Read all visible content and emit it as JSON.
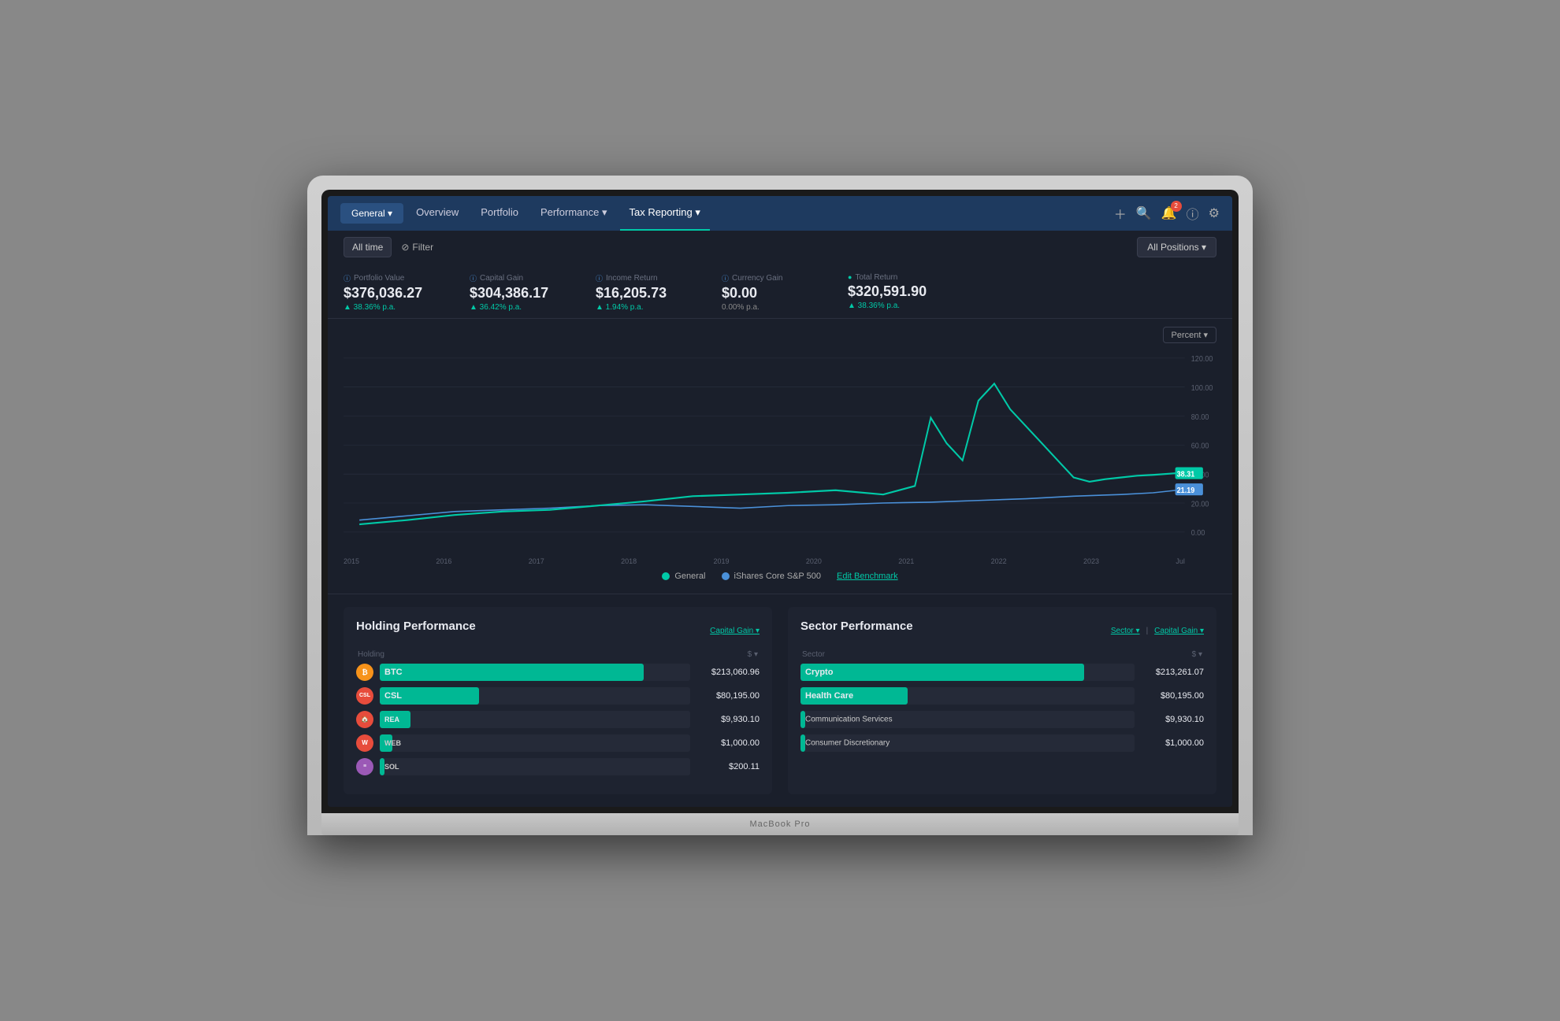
{
  "nav": {
    "general_label": "General ▾",
    "overview_label": "Overview",
    "portfolio_label": "Portfolio",
    "performance_label": "Performance ▾",
    "tax_reporting_label": "Tax Reporting ▾",
    "notification_count": "2"
  },
  "toolbar": {
    "time_filter": "All time",
    "filter_label": "Filter",
    "positions_label": "All Positions ▾"
  },
  "metrics": {
    "portfolio_value_label": "Portfolio Value",
    "portfolio_value": "$376,036.27",
    "portfolio_change": "▲ 38.36% p.a.",
    "capital_gain_label": "Capital Gain",
    "capital_gain": "$304,386.17",
    "capital_gain_change": "▲ 36.42% p.a.",
    "income_return_label": "Income Return",
    "income_return": "$16,205.73",
    "income_return_change": "▲ 1.94% p.a.",
    "currency_gain_label": "Currency Gain",
    "currency_gain": "$0.00",
    "currency_gain_change": "0.00% p.a.",
    "total_return_label": "Total Return",
    "total_return": "$320,591.90",
    "total_return_change": "▲ 38.36% p.a."
  },
  "chart": {
    "type_label": "Percent ▾",
    "y_labels": [
      "120.00",
      "100.00",
      "80.00",
      "60.00",
      "40.00",
      "20.00",
      "0.00"
    ],
    "x_labels": [
      "2015",
      "2016",
      "2017",
      "2018",
      "2019",
      "2020",
      "2021",
      "2022",
      "2023",
      "Jul"
    ],
    "general_tag": "38.31",
    "benchmark_tag": "21.19",
    "legend_general": "General",
    "legend_benchmark": "iShares Core S&P 500",
    "edit_benchmark": "Edit Benchmark"
  },
  "holding_performance": {
    "title": "Holding Performance",
    "col_holding": "Holding",
    "col_value": "$ ▾",
    "sort_label": "Capital Gain ▾",
    "rows": [
      {
        "ticker": "BTC",
        "color": "#f7931a",
        "bg": "#f7931a",
        "bar_pct": 85,
        "bar_color": "#00b894",
        "value": "$213,060.96"
      },
      {
        "ticker": "CSL",
        "color": "#e74c3c",
        "bg": "#e74c3c",
        "bar_pct": 32,
        "bar_color": "#00b894",
        "value": "$80,195.00"
      },
      {
        "ticker": "REA",
        "color": "#e74c3c",
        "bg": "#e74c3c",
        "bar_pct": 10,
        "bar_color": "#00b894",
        "value": "$9,930.10"
      },
      {
        "ticker": "WEB",
        "color": "#e74c3c",
        "bg": "#e74c3c",
        "bar_pct": 4,
        "bar_color": "#00b894",
        "value": "$1,000.00"
      },
      {
        "ticker": "SOL",
        "color": "#9b59b6",
        "bg": "#9b59b6",
        "bar_pct": 1,
        "bar_color": "#00b894",
        "value": "$200.11"
      }
    ]
  },
  "sector_performance": {
    "title": "Sector Performance",
    "col_sector": "Sector",
    "col_value": "$ ▾",
    "sort_sector": "Sector ▾",
    "sort_capital": "Capital Gain ▾",
    "rows": [
      {
        "name": "Crypto",
        "bar_pct": 85,
        "bar_color": "#00b894",
        "value": "$213,261.07"
      },
      {
        "name": "Health Care",
        "bar_pct": 32,
        "bar_color": "#00b894",
        "value": "$80,195.00"
      },
      {
        "name": "Communication Services",
        "bar_pct": 0,
        "bar_color": "#00b894",
        "value": "$9,930.10"
      },
      {
        "name": "Consumer Discretionary",
        "bar_pct": 0,
        "bar_color": "#00b894",
        "value": "$1,000.00"
      }
    ]
  },
  "macbook_label": "MacBook Pro"
}
